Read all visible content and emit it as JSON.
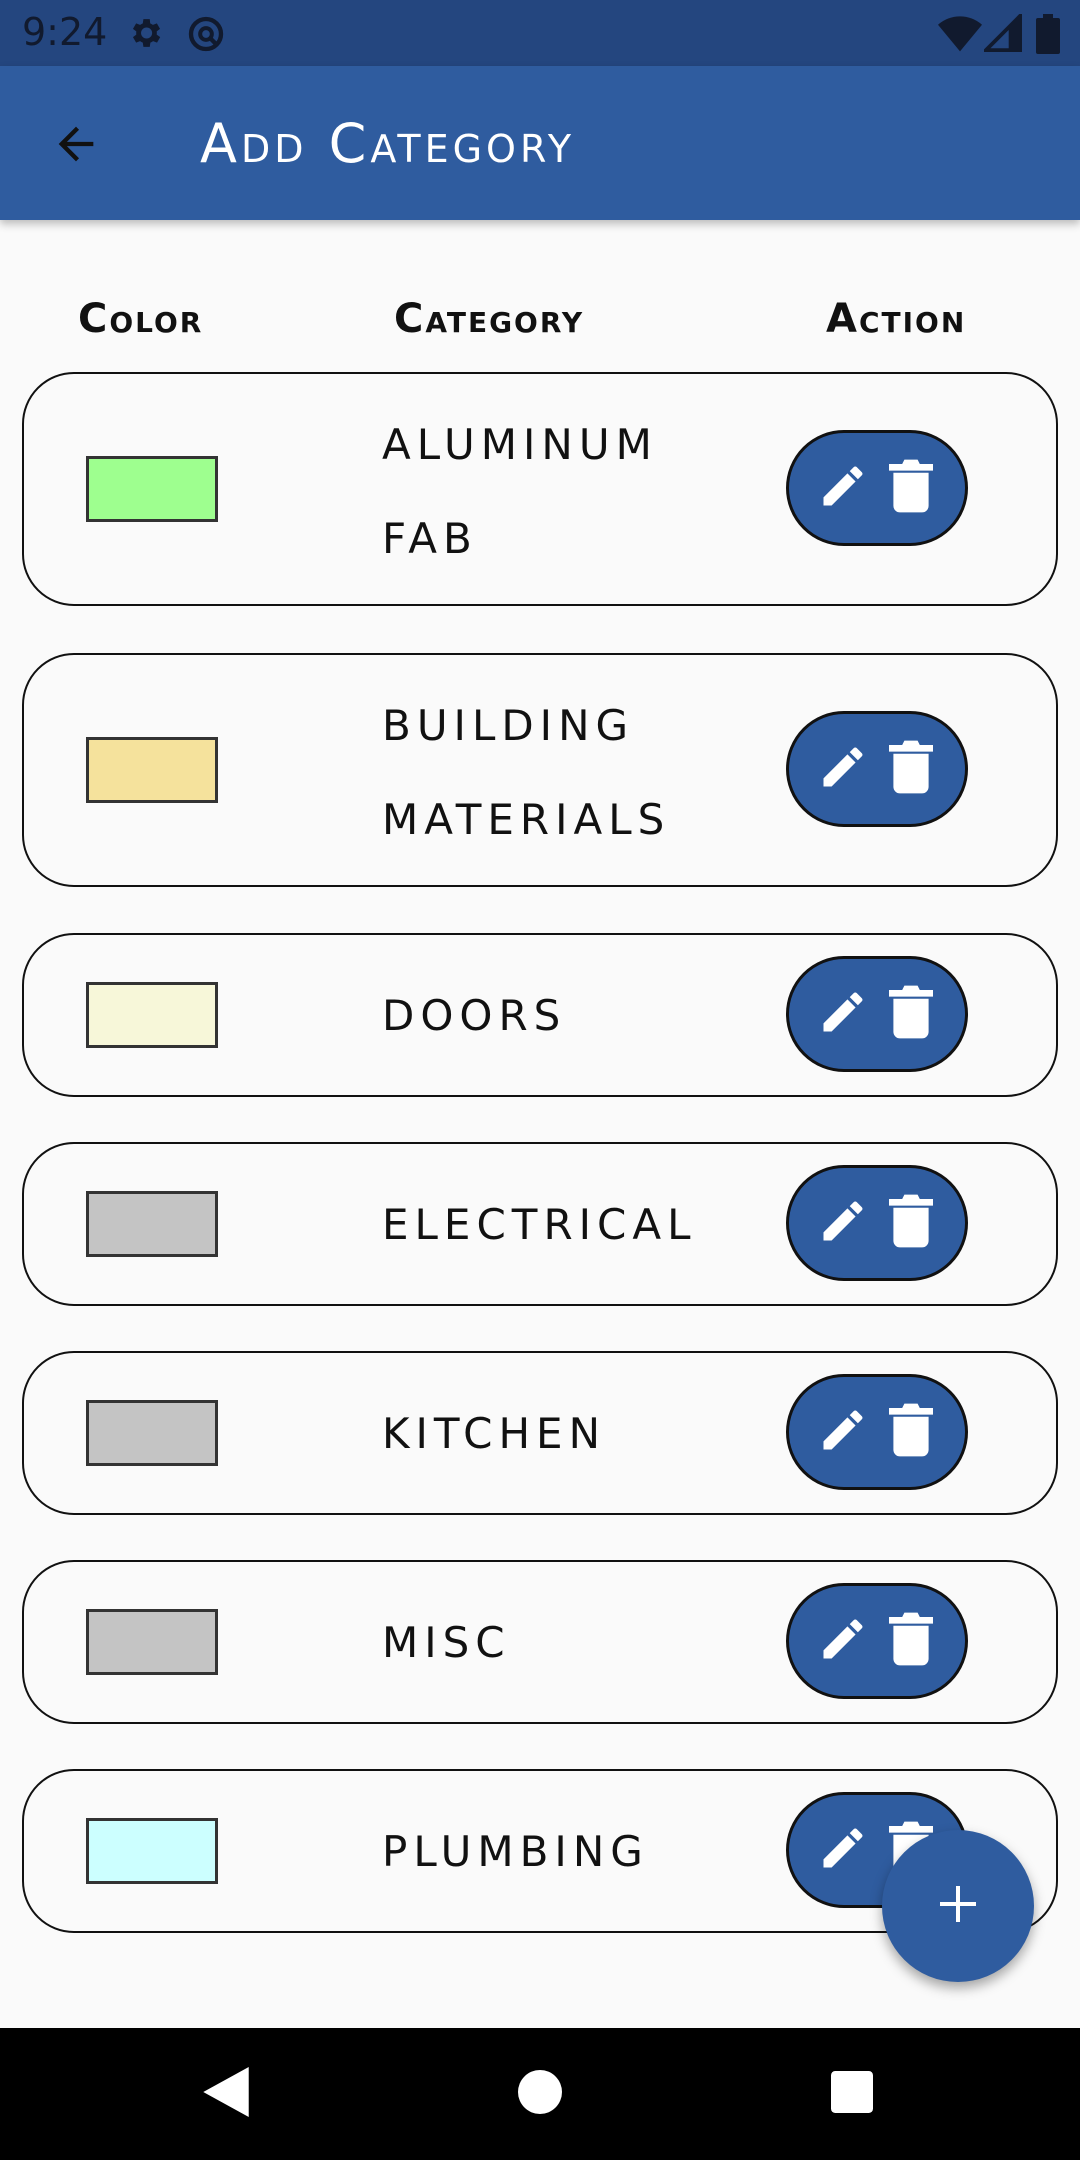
{
  "status_bar": {
    "time": "9:24",
    "icons": [
      "gear-icon",
      "sync-icon",
      "wifi-icon",
      "signal-icon",
      "battery-icon"
    ]
  },
  "app_bar": {
    "title": "Add Category",
    "back_icon": "arrow-left-icon"
  },
  "columns": {
    "color": "Color",
    "category": "Category",
    "action": "Action"
  },
  "rows": [
    {
      "name_line1": "ALUMINUM",
      "name_line2": "FAB",
      "color": "#9eff8f"
    },
    {
      "name_line1": "BUILDING",
      "name_line2": "MATERIALS",
      "color": "#f5e29c"
    },
    {
      "name_line1": "DOORS",
      "name_line2": "",
      "color": "#f7f7d9"
    },
    {
      "name_line1": "ELECTRICAL",
      "name_line2": "",
      "color": "#c4c4c4"
    },
    {
      "name_line1": "KITCHEN",
      "name_line2": "",
      "color": "#c4c4c4"
    },
    {
      "name_line1": "MISC",
      "name_line2": "",
      "color": "#c4c4c4"
    },
    {
      "name_line1": "PLUMBING",
      "name_line2": "",
      "color": "#ccffff"
    }
  ],
  "action_icons": [
    "pencil-icon",
    "trash-icon"
  ],
  "fab": {
    "icon": "plus-icon"
  },
  "nav": {
    "icons": [
      "triangle-back-icon",
      "circle-home-icon",
      "square-recents-icon"
    ]
  },
  "colors": {
    "status_bar": "#24467f",
    "primary": "#2f5c9f",
    "background": "#fafafa"
  }
}
